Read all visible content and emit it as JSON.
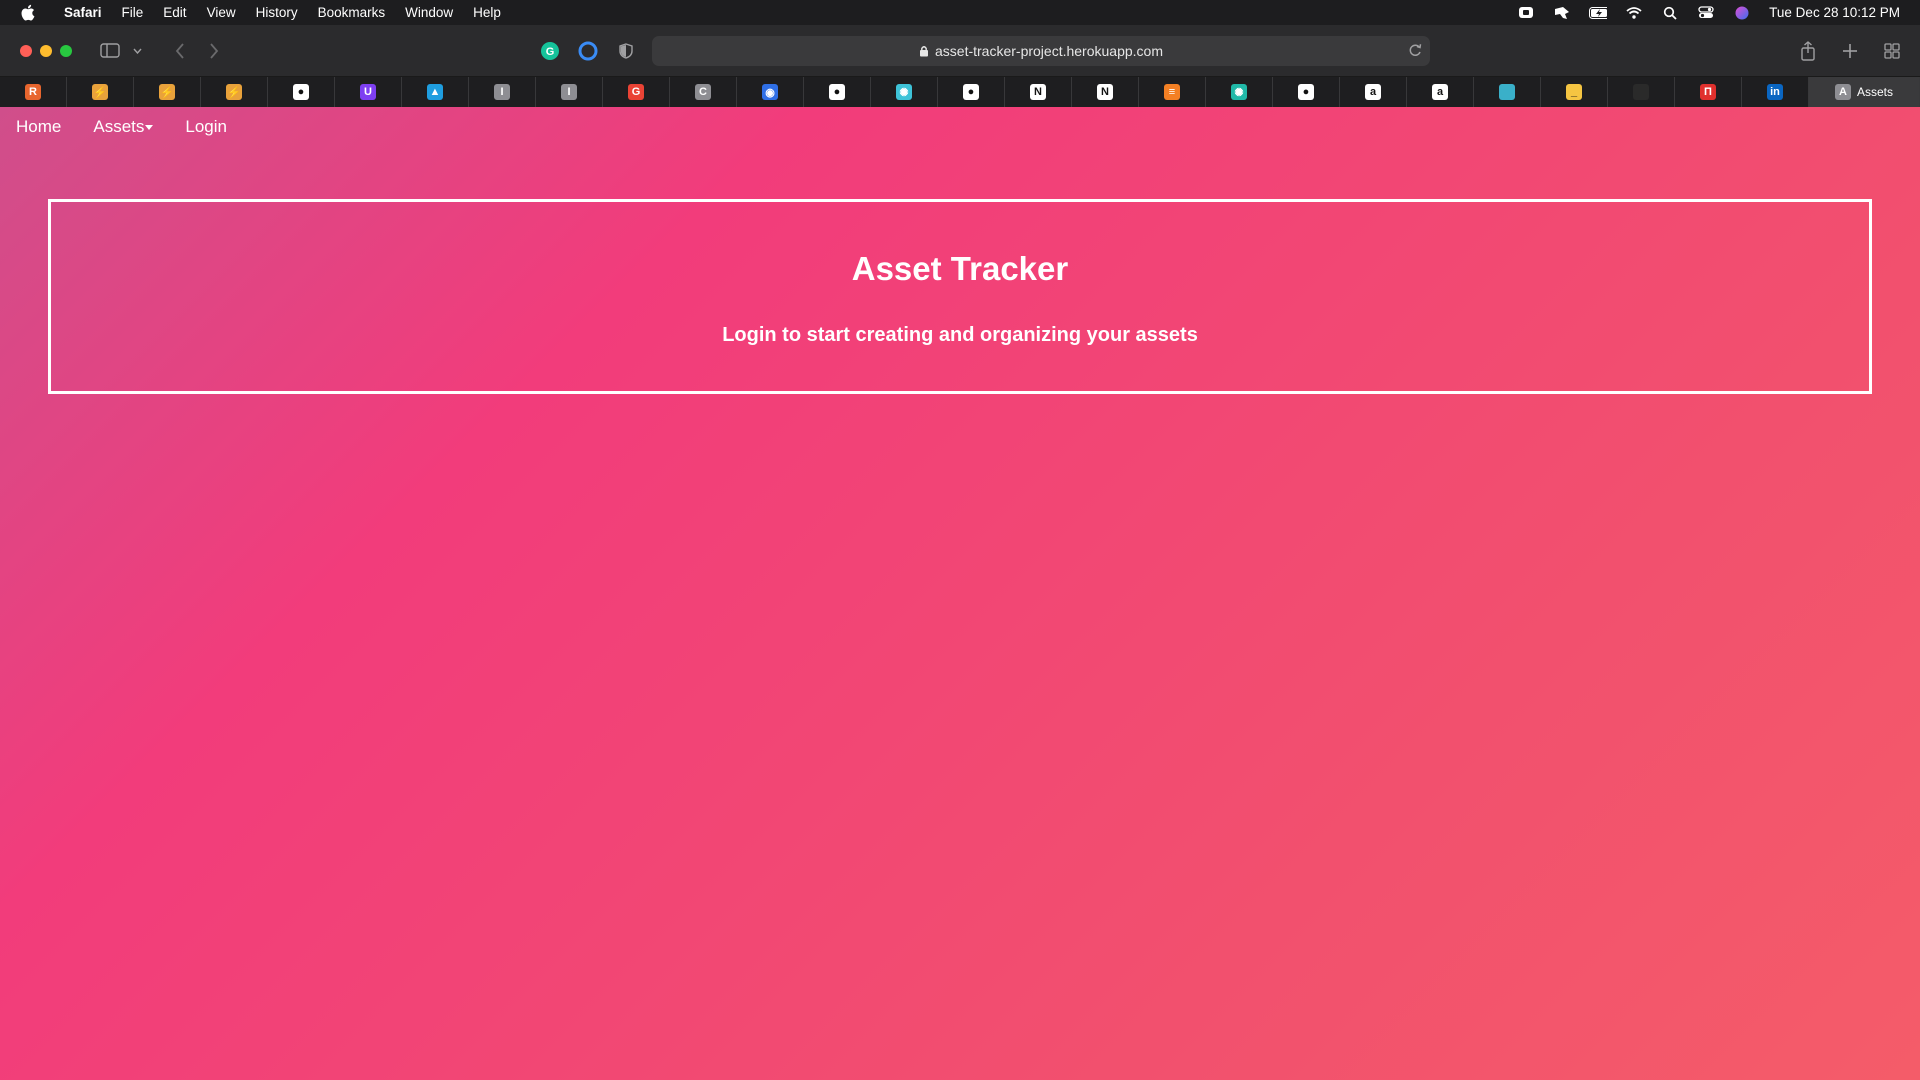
{
  "menubar": {
    "app_name": "Safari",
    "items": [
      "File",
      "Edit",
      "View",
      "History",
      "Bookmarks",
      "Window",
      "Help"
    ],
    "clock": "Tue Dec 28  10:12 PM",
    "status_icons": [
      "screen-record-icon",
      "cursor-app-icon",
      "battery-icon",
      "wifi-icon",
      "spotlight-search-icon",
      "control-center-icon",
      "siri-icon"
    ]
  },
  "browser": {
    "url": "asset-tracker-project.herokuapp.com",
    "tabs": [
      {
        "icon": "rss-icon",
        "color": "#e8662e",
        "glyph": "R"
      },
      {
        "icon": "bolt-icon",
        "color": "#e9a23b",
        "glyph": "⚡"
      },
      {
        "icon": "bolt-icon",
        "color": "#e9a23b",
        "glyph": "⚡"
      },
      {
        "icon": "bolt-icon",
        "color": "#e9a23b",
        "glyph": "⚡"
      },
      {
        "icon": "github-icon",
        "color": "#ffffff",
        "glyph": "●"
      },
      {
        "icon": "u-badge-icon",
        "color": "#7e3ff2",
        "glyph": "U"
      },
      {
        "icon": "bird-icon",
        "color": "#1f9ee0",
        "glyph": "▲"
      },
      {
        "icon": "letter-i-icon",
        "color": "#8e8e93",
        "glyph": "I"
      },
      {
        "icon": "letter-i-icon",
        "color": "#8e8e93",
        "glyph": "I"
      },
      {
        "icon": "google-icon",
        "color": "#ea4335",
        "glyph": "G"
      },
      {
        "icon": "letter-c-icon",
        "color": "#8e8e93",
        "glyph": "C"
      },
      {
        "icon": "circle-target-icon",
        "color": "#2f6fe6",
        "glyph": "◉"
      },
      {
        "icon": "github-icon",
        "color": "#ffffff",
        "glyph": "●"
      },
      {
        "icon": "react-icon",
        "color": "#3ec3d8",
        "glyph": "✺"
      },
      {
        "icon": "github-icon",
        "color": "#ffffff",
        "glyph": "●"
      },
      {
        "icon": "notion-icon",
        "color": "#ffffff",
        "glyph": "N"
      },
      {
        "icon": "notion-icon",
        "color": "#ffffff",
        "glyph": "N"
      },
      {
        "icon": "stack-overflow-icon",
        "color": "#f48024",
        "glyph": "≡"
      },
      {
        "icon": "react-icon",
        "color": "#21b9a8",
        "glyph": "✺"
      },
      {
        "icon": "github-icon",
        "color": "#ffffff",
        "glyph": "●"
      },
      {
        "icon": "amazon-icon",
        "color": "#ffffff",
        "glyph": "a"
      },
      {
        "icon": "amazon-icon",
        "color": "#ffffff",
        "glyph": "a"
      },
      {
        "icon": "teal-square-icon",
        "color": "#3ab0c9",
        "glyph": ""
      },
      {
        "icon": "underscore-icon",
        "color": "#f5c542",
        "glyph": "_"
      },
      {
        "icon": "dark-square-icon",
        "color": "#2a2a2a",
        "glyph": ""
      },
      {
        "icon": "red-square-icon",
        "color": "#e0302d",
        "glyph": "П"
      },
      {
        "icon": "linkedin-icon",
        "color": "#0a66c2",
        "glyph": "in"
      }
    ],
    "active_tab": {
      "favicon_letter": "A",
      "title": "Assets"
    }
  },
  "page": {
    "nav": {
      "home": "Home",
      "assets": "Assets",
      "login": "Login"
    },
    "hero": {
      "title": "Asset Tracker",
      "subtitle": "Login to start creating and organizing your assets"
    }
  }
}
